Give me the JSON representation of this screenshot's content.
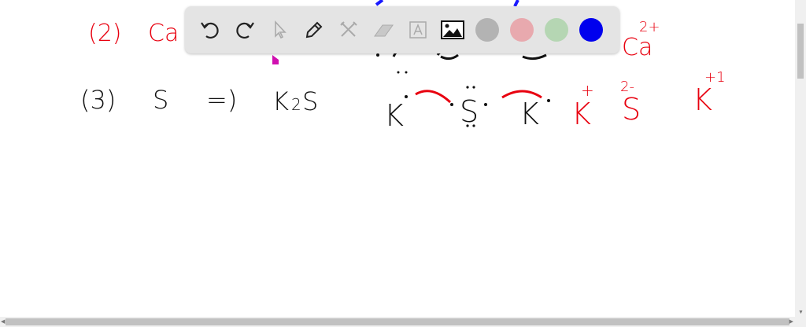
{
  "board": {
    "line2": {
      "label": "(2)",
      "element": "Ca",
      "ion_base": "Ca",
      "ion_charge": "2+"
    },
    "line3": {
      "label": "(3)",
      "element": "S",
      "arrow": "=)",
      "formula_k": "K",
      "formula_sub": "2",
      "formula_s": "S"
    },
    "lewis": {
      "k1": "K",
      "s": "S",
      "k2": "K"
    },
    "ions": {
      "k_plus": "K",
      "k_plus_charge": "+",
      "s": "S",
      "s_charge": "2-",
      "k_plus1": "K",
      "k_plus1_charge": "+1"
    }
  },
  "toolbar": {
    "tools": [
      "undo-icon",
      "redo-icon",
      "select-icon",
      "pen-icon",
      "tools-icon",
      "eraser-icon",
      "text-icon",
      "image-icon"
    ],
    "colors": [
      "#b3b3b3",
      "#e8a9ae",
      "#b5d6b3",
      "#0000ee"
    ]
  },
  "ink": {
    "red": "#e8000f",
    "black": "#111111",
    "blue": "#1a1aff",
    "cursor": "#d010b0"
  }
}
